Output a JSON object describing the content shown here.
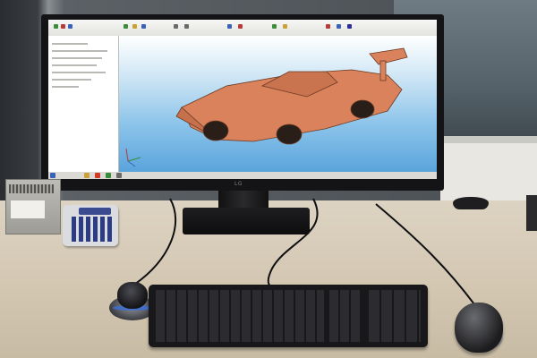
{
  "photo": {
    "brand_logo_text": "LG",
    "icons": [
      "monitor-icon",
      "keyboard-icon",
      "mouse-icon",
      "3d-mouse-icon",
      "calculator-icon"
    ]
  },
  "colors": {
    "viewport_sky": "#8cc4ea",
    "model_copper": "#d9825c",
    "desk": "#d3c7b2",
    "device_black": "#141416"
  }
}
